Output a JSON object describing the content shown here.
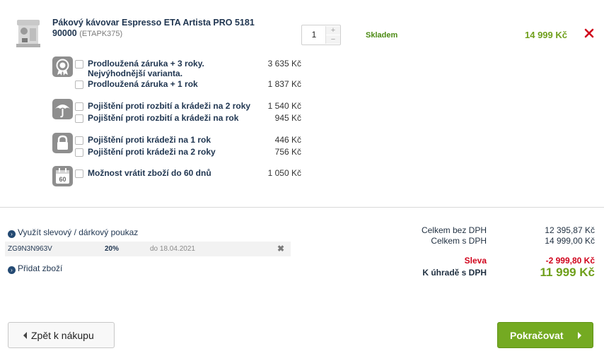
{
  "product": {
    "name": "Pákový kávovar Espresso ETA Artista PRO 5181 90000",
    "code": "(ETAPK375)",
    "quantity": "1",
    "qty_plus": "+",
    "qty_minus": "−",
    "stock": "Skladem",
    "price": "14 999 Kč",
    "remove_icon": "close-icon"
  },
  "services": [
    {
      "icon": "warranty-badge-icon",
      "items": [
        {
          "label": "Prodloužená záruka + 3 roky.",
          "label2": "Nejvýhodnější varianta.",
          "price": "3 635 Kč"
        },
        {
          "label": "Prodloužená záruka + 1 rok",
          "price": "1 837 Kč"
        }
      ]
    },
    {
      "icon": "umbrella-icon",
      "items": [
        {
          "label": "Pojištění proti rozbití a krádeži na 2 roky",
          "price": "1 540 Kč"
        },
        {
          "label": "Pojištění proti rozbití a krádeži na rok",
          "price": "945 Kč"
        }
      ]
    },
    {
      "icon": "lock-icon",
      "items": [
        {
          "label": "Pojištění proti krádeži na 1 rok",
          "price": "446 Kč"
        },
        {
          "label": "Pojištění proti krádeži na 2 roky",
          "price": "756 Kč"
        }
      ]
    },
    {
      "icon": "calendar-60-icon",
      "icon_text": "60",
      "items": [
        {
          "label": "Možnost vrátit zboží do 60 dnů",
          "price": "1 050 Kč"
        }
      ]
    }
  ],
  "voucher": {
    "link": "Využít slevový / dárkový poukaz",
    "code": "ZG9N3N963V",
    "percent": "20%",
    "valid": "do 18.04.2021",
    "remove": "✖"
  },
  "add_items_link": "Přidat zboží",
  "summary": {
    "without_vat_label": "Celkem bez DPH",
    "without_vat": "12 395,87 Kč",
    "with_vat_label": "Celkem s DPH",
    "with_vat": "14 999,00 Kč",
    "discount_label": "Sleva",
    "discount": "-2 999,80 Kč",
    "total_label": "K úhradě s DPH",
    "total": "11 999 Kč"
  },
  "buttons": {
    "back": "Zpět k nákupu",
    "continue": "Pokračovat"
  },
  "colors": {
    "accent_green": "#74aa22",
    "price_green": "#6f9f1b",
    "discount_red": "#d0021b",
    "link_blue": "#1f3550"
  }
}
